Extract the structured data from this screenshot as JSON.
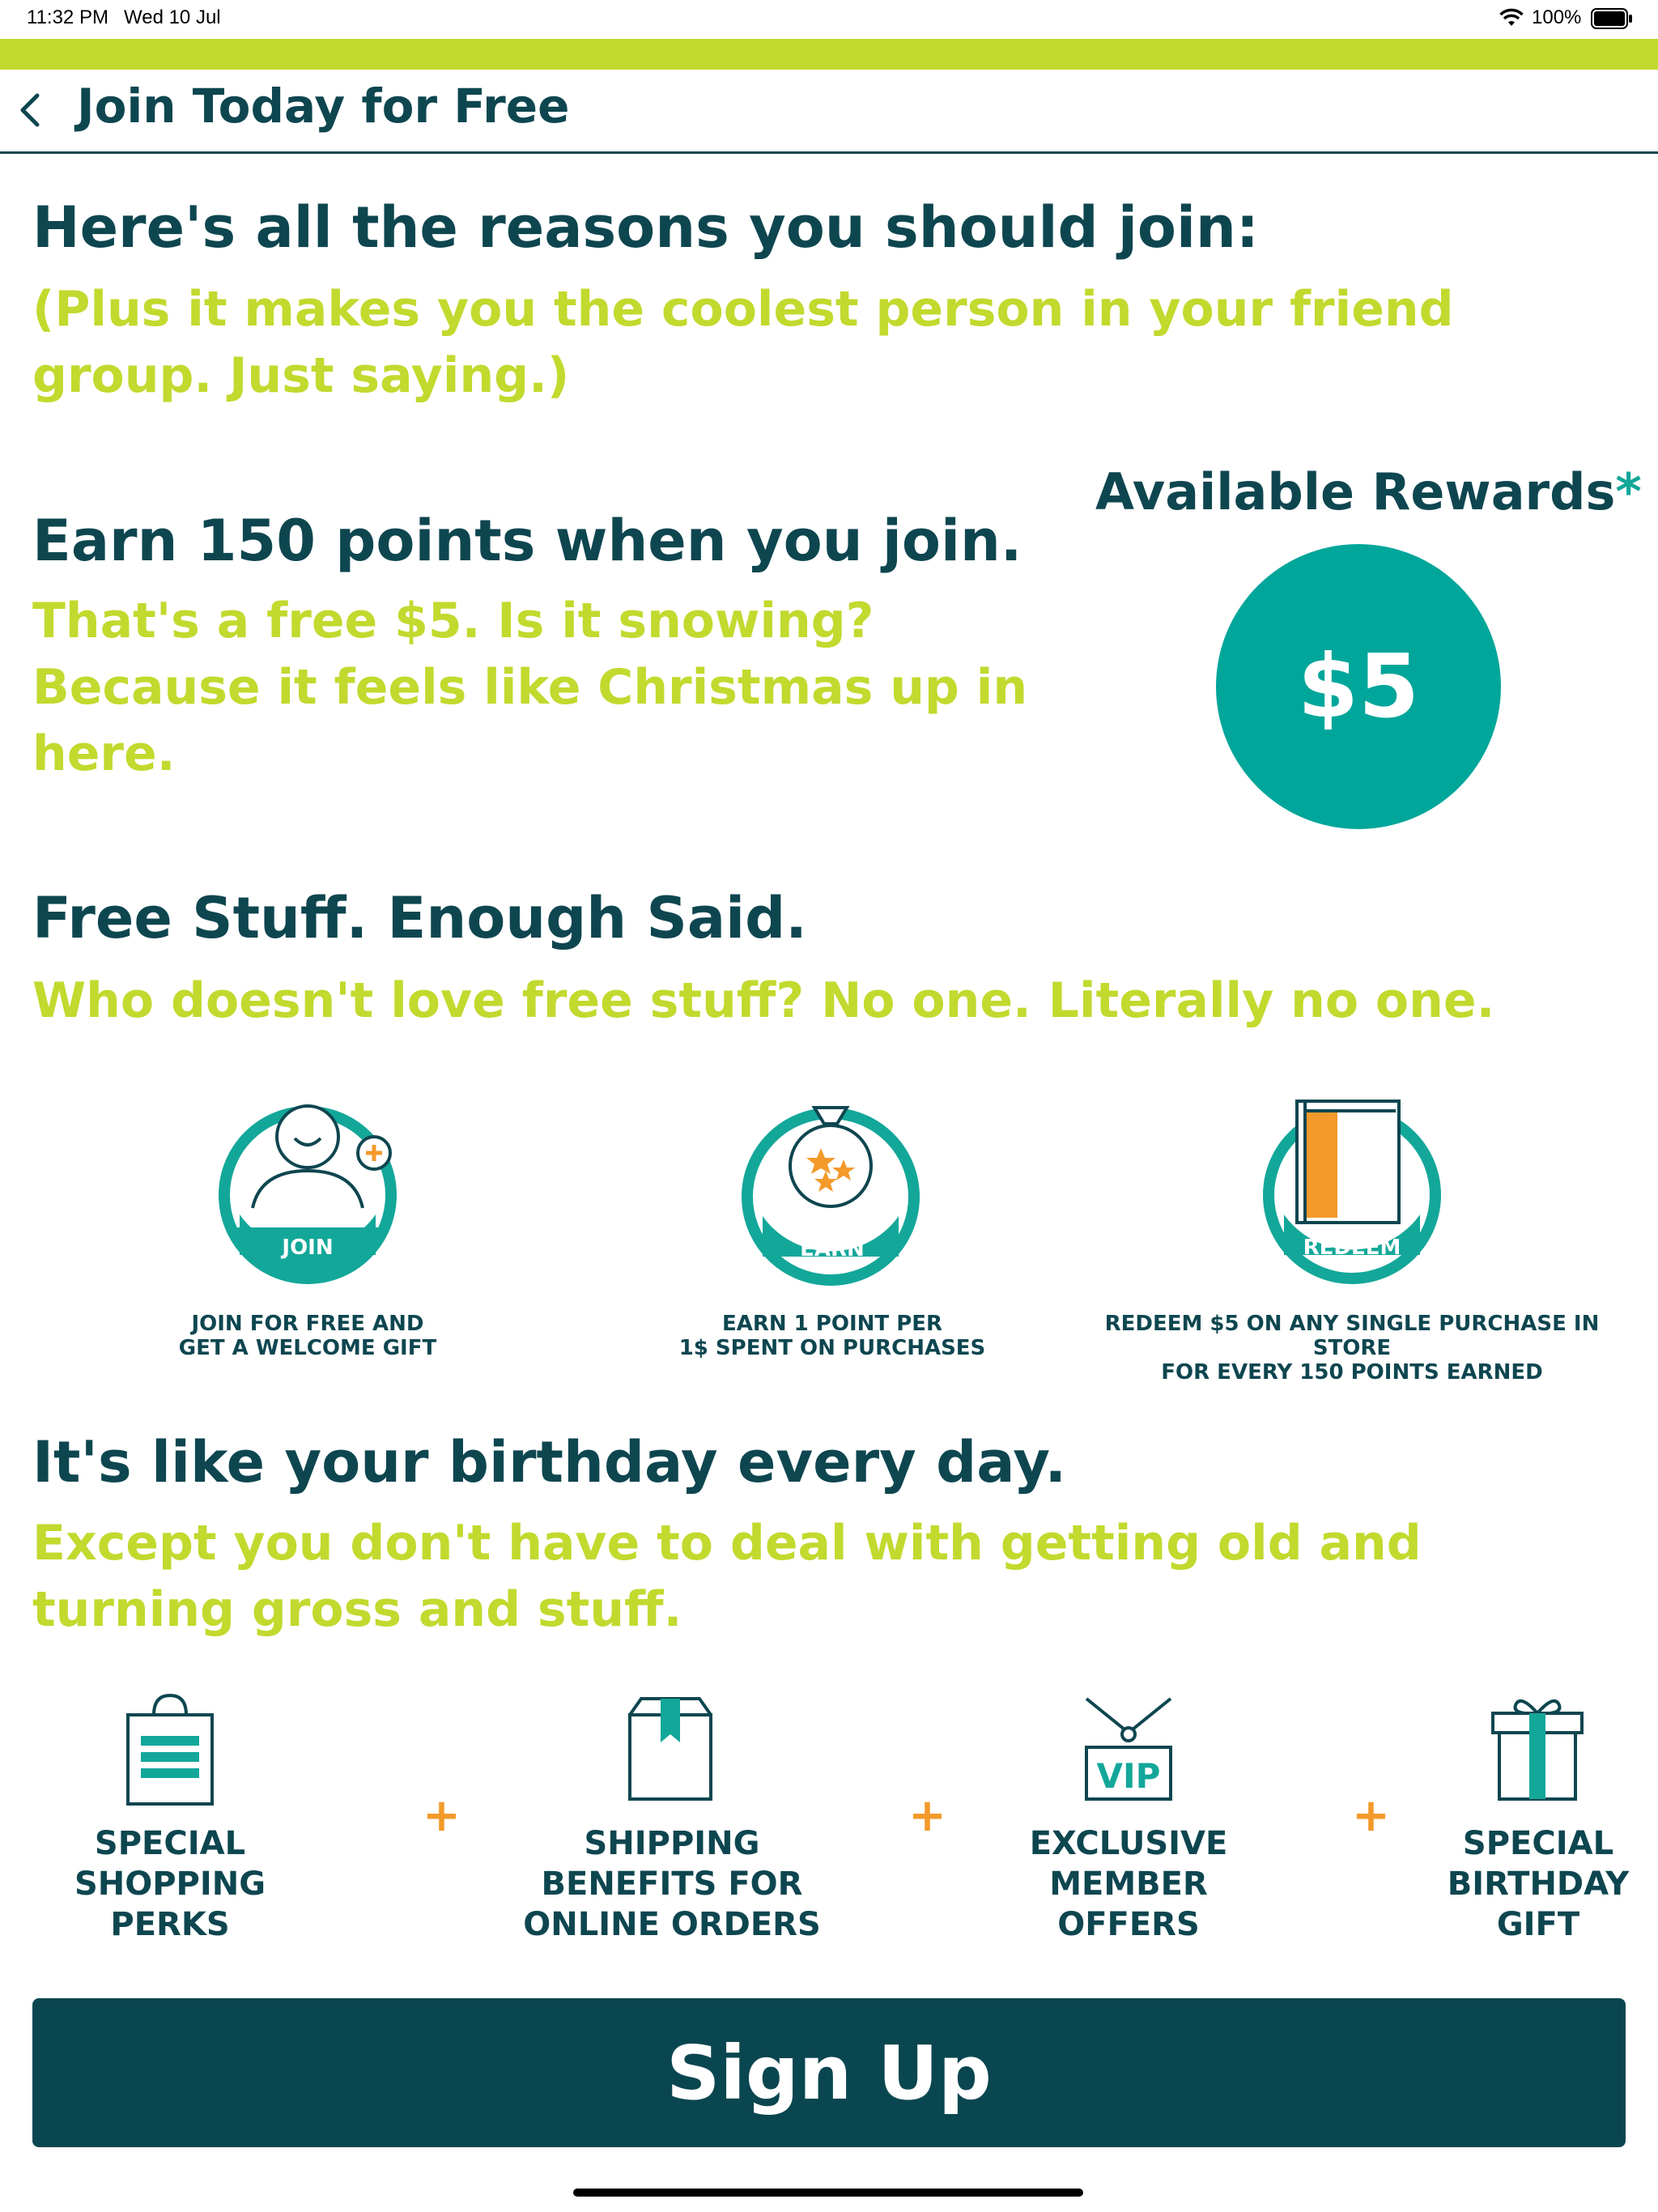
{
  "status_bar": {
    "time": "11:32 PM",
    "date": "Wed 10 Jul",
    "battery": "100%"
  },
  "header": {
    "title": "Join Today for Free"
  },
  "sections": {
    "reasons": {
      "heading": "Here's all the reasons you should join:",
      "line1": "(Plus it makes you the coolest person in your friend",
      "line2": "group. Just saying.)"
    },
    "points": {
      "heading": "Earn 150 points when you join.",
      "line1": "That's a free $5. Is it snowing?",
      "line2": "Because it feels like Christmas up in",
      "line3": "here."
    },
    "free_stuff": {
      "heading": "Free Stuff. Enough Said.",
      "line1": "Who doesn't love free stuff? No one. Literally no one."
    },
    "birthday": {
      "heading": "It's like your birthday every day.",
      "line1": "Except you don't have to deal with getting old and",
      "line2": "turning gross and stuff."
    }
  },
  "rewards": {
    "label": "Available Rewards",
    "asterisk": "*",
    "amount": "$5"
  },
  "steps": [
    {
      "badge": "JOIN",
      "line1": "JOIN FOR FREE AND",
      "line2": "GET A WELCOME GIFT"
    },
    {
      "badge": "EARN",
      "line1": "EARN 1 POINT PER",
      "line2": "1$ SPENT ON PURCHASES"
    },
    {
      "badge": "REDEEM",
      "line1": "REDEEM $5 ON ANY SINGLE PURCHASE IN STORE",
      "line2": "FOR EVERY 150 POINTS EARNED"
    }
  ],
  "perks": [
    {
      "lines": [
        "SPECIAL",
        "SHOPPING",
        "PERKS"
      ]
    },
    {
      "lines": [
        "SHIPPING",
        "BENEFITS FOR",
        "ONLINE ORDERS"
      ]
    },
    {
      "lines": [
        "EXCLUSIVE",
        "MEMBER",
        "OFFERS"
      ],
      "icon_text": "VIP"
    },
    {
      "lines": [
        "SPECIAL",
        "BIRTHDAY",
        "GIFT"
      ]
    }
  ],
  "plus_sign": "+",
  "signup_label": "Sign Up",
  "colors": {
    "dark_teal": "#0e4650",
    "lime": "#c2d92e",
    "teal": "#00a69a",
    "orange": "#f39a2b"
  }
}
